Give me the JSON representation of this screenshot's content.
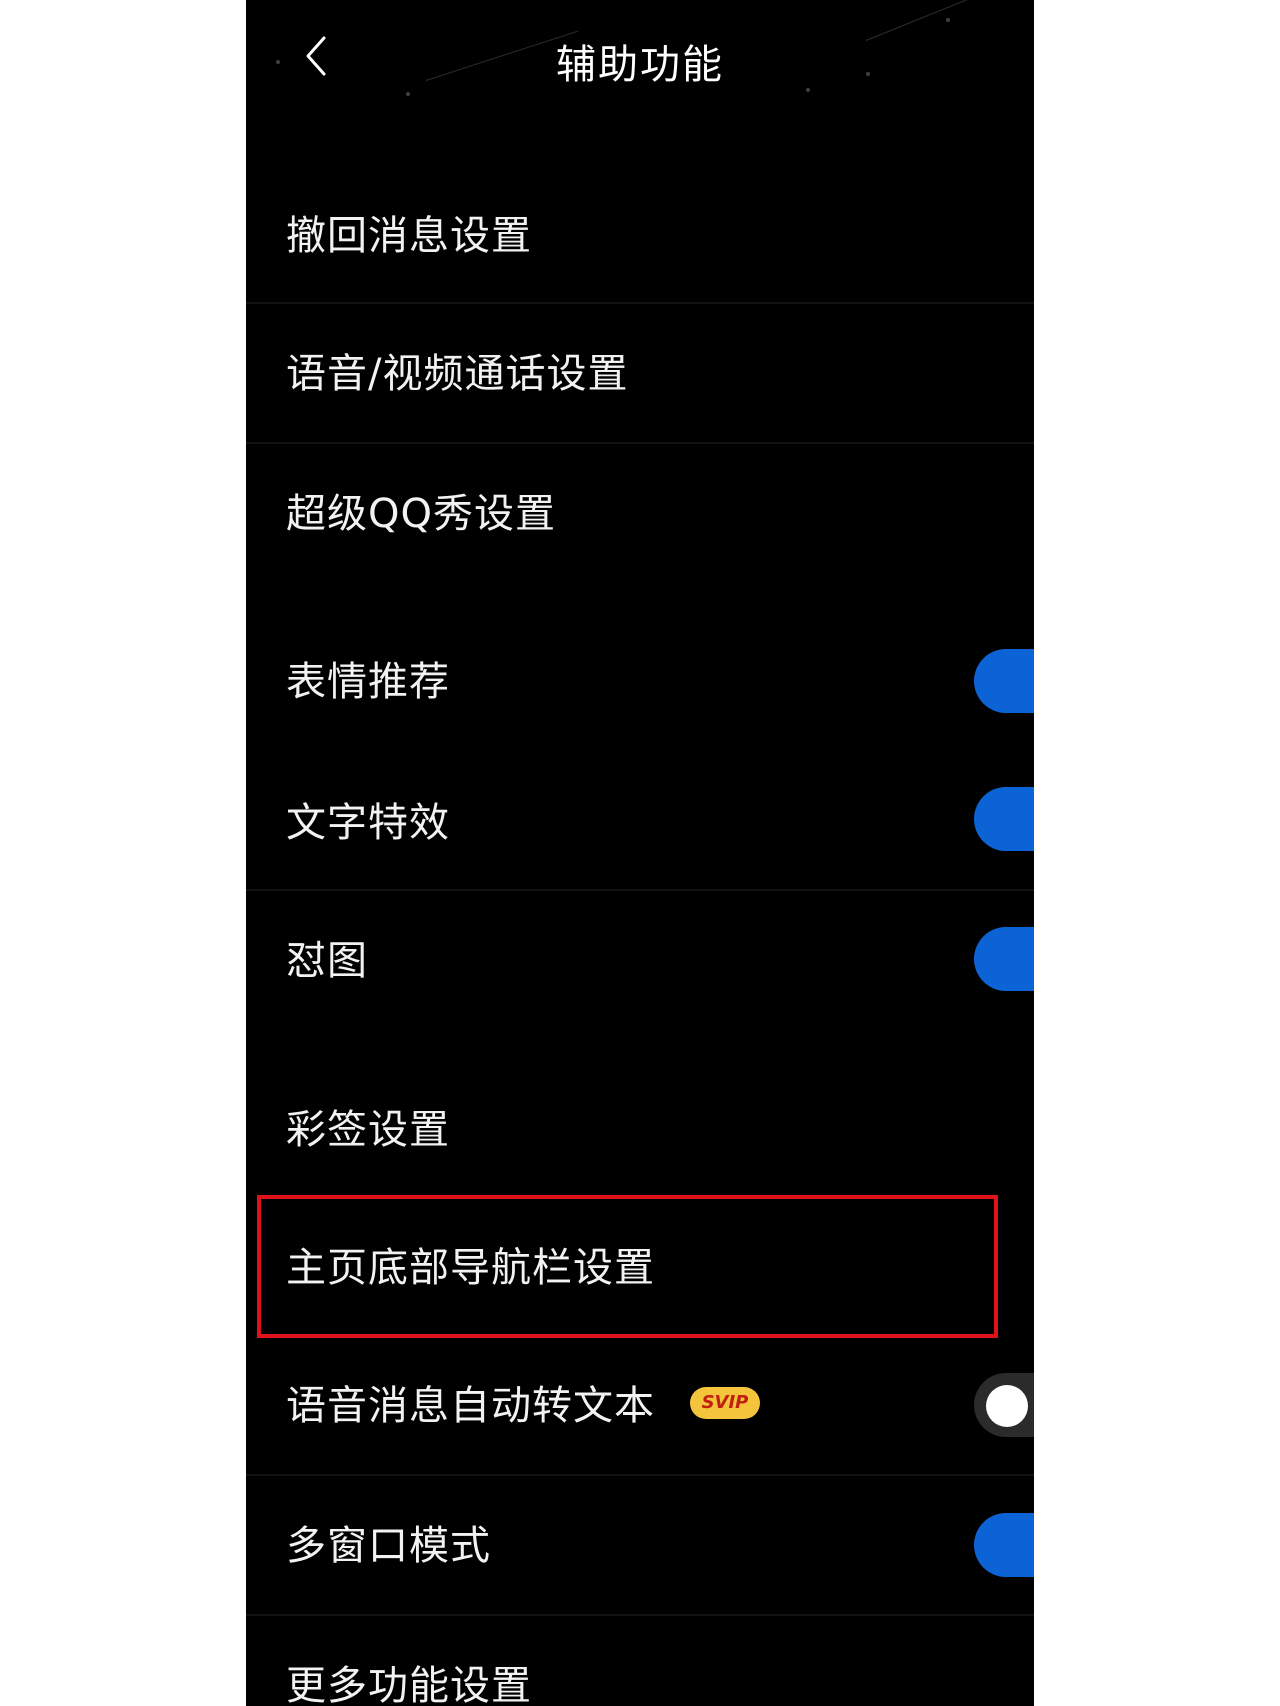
{
  "header": {
    "title": "辅助功能",
    "back_icon": "chevron-left-icon"
  },
  "settings": {
    "recall": {
      "label": "撤回消息设置"
    },
    "call": {
      "label": "语音/视频通话设置"
    },
    "super_show": {
      "label": "超级QQ秀设置"
    },
    "emoji_recommend": {
      "label": "表情推荐",
      "enabled": true
    },
    "text_effect": {
      "label": "文字特效",
      "enabled": true
    },
    "meme": {
      "label": "怼图",
      "enabled": true
    },
    "color_tag": {
      "label": "彩签设置"
    },
    "bottom_nav": {
      "label": "主页底部导航栏设置",
      "highlighted": true
    },
    "voice_to_text": {
      "label": "语音消息自动转文本",
      "badge": "SVIP",
      "enabled": false
    },
    "multi_window": {
      "label": "多窗口模式",
      "enabled": true
    },
    "more": {
      "label": "更多功能设置"
    }
  },
  "colors": {
    "background": "#000000",
    "toggle_on": "#0b63d6",
    "highlight": "#e0121a",
    "svip_badge": "#f3c43c"
  }
}
